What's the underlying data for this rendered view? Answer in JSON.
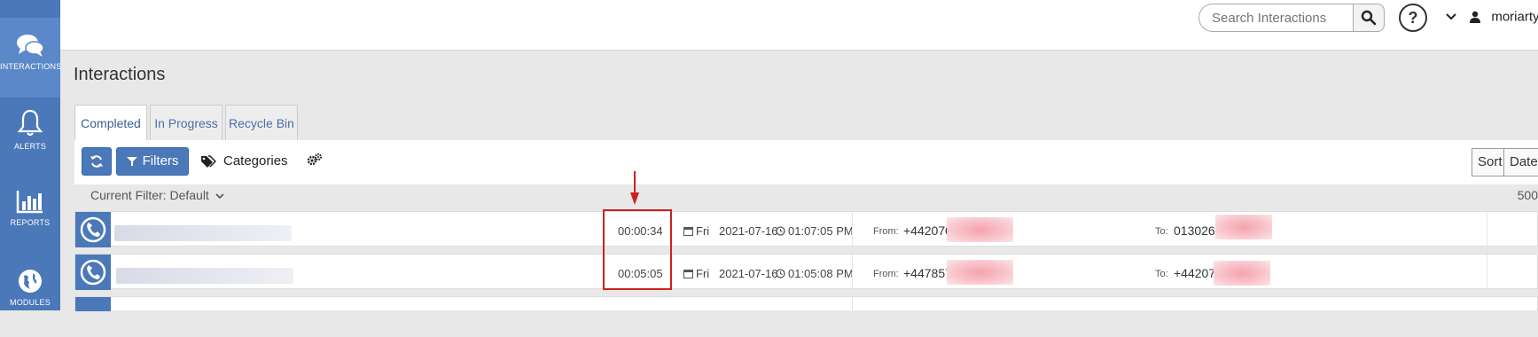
{
  "sidebar": {
    "items": [
      {
        "label": "INTERACTIONS",
        "icon": "chat-bubbles-icon"
      },
      {
        "label": "ALERTS",
        "icon": "bell-icon"
      },
      {
        "label": "REPORTS",
        "icon": "bar-chart-icon"
      },
      {
        "label": "MODULES",
        "icon": "globe-icon"
      }
    ]
  },
  "header": {
    "search_placeholder": "Search Interactions",
    "help_label": "?",
    "username": "moriarty"
  },
  "page": {
    "title": "Interactions",
    "tabs": [
      {
        "label": "Completed",
        "active": true
      },
      {
        "label": "In Progress",
        "active": false
      },
      {
        "label": "Recycle Bin",
        "active": false
      }
    ]
  },
  "toolbar": {
    "filters_label": "Filters",
    "categories_label": "Categories",
    "sort_label": "Sort",
    "sort_value": "Date"
  },
  "filter_bar": {
    "current_filter": "Current Filter: Default",
    "count": "500"
  },
  "interactions": [
    {
      "duration": "00:00:34",
      "day": "Fri",
      "date": "2021-07-16",
      "time": "01:07:05 PM",
      "from_label": "From:",
      "from": "+442070",
      "to_label": "To:",
      "to": "013026"
    },
    {
      "duration": "00:05:05",
      "day": "Fri",
      "date": "2021-07-16",
      "time": "01:05:08 PM",
      "from_label": "From:",
      "from": "+447857",
      "to_label": "To:",
      "to": "+44207"
    }
  ],
  "colors": {
    "accent": "#4a78b8",
    "highlight": "#cc2222",
    "redaction": "#f5a3ad"
  }
}
